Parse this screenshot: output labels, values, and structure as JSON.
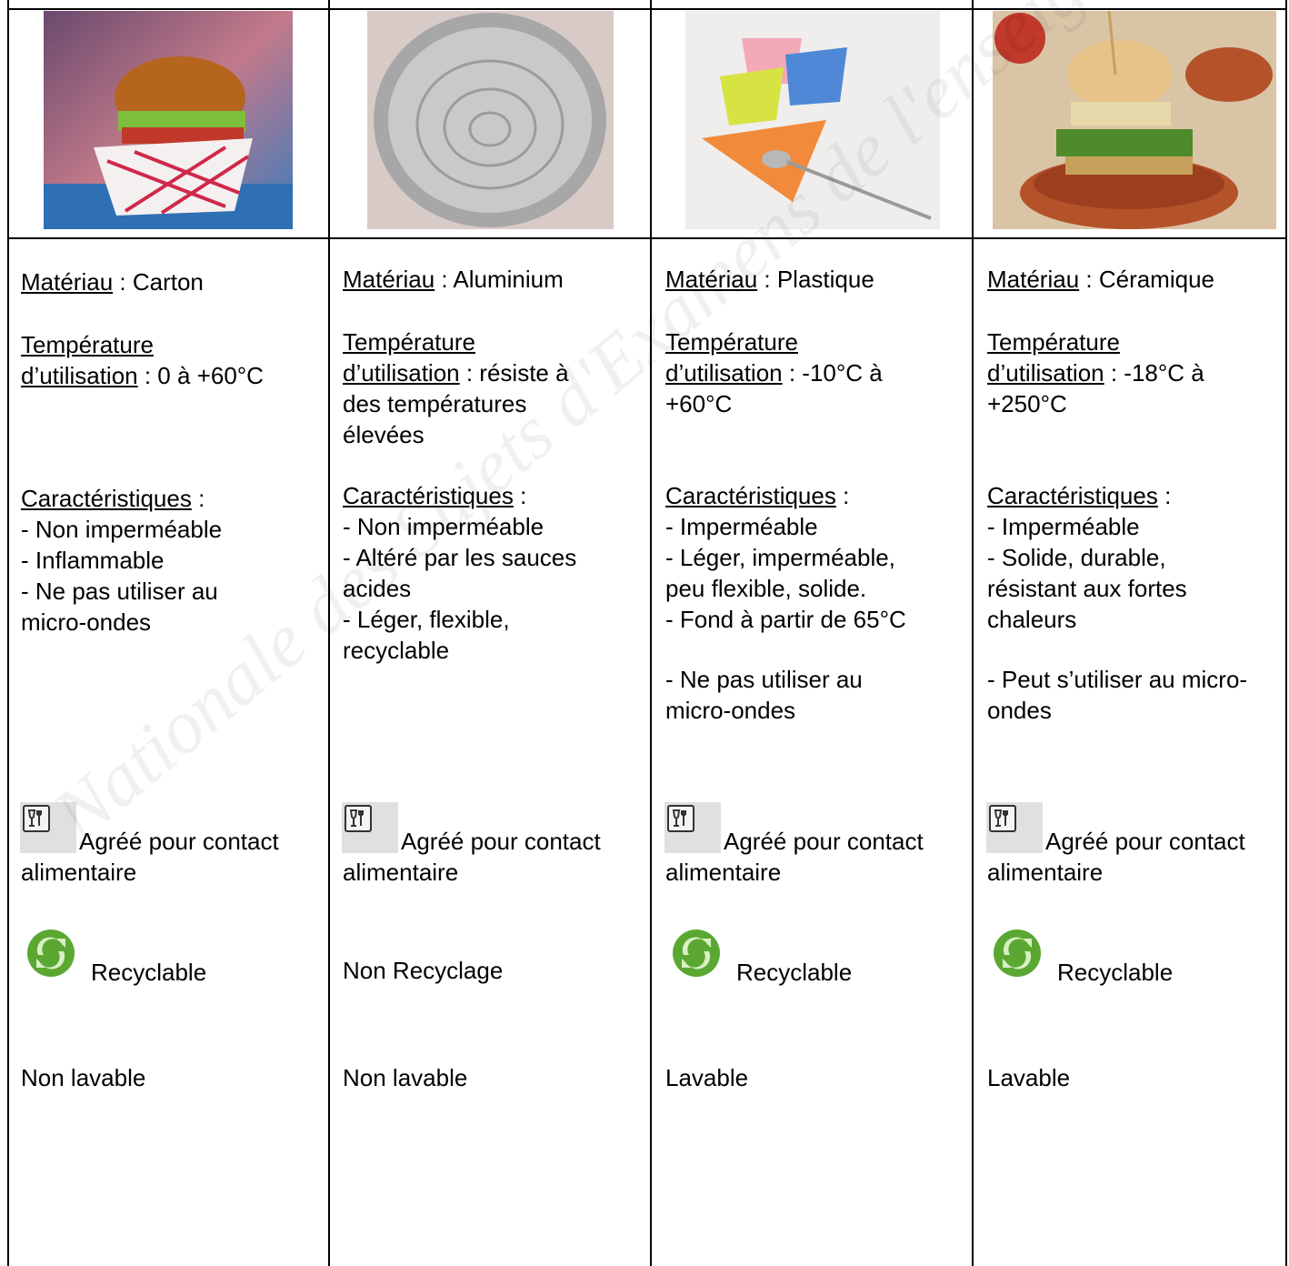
{
  "columns": [
    {
      "material_label": "Matériau",
      "material_sep": " : ",
      "material_value": "Carton",
      "temp_label_1": "Température",
      "temp_label_2": "d’utilisation",
      "temp_lines": [
        " : 0 à +60°C"
      ],
      "char_label": "Caractéristiques",
      "char_sep": " :",
      "char_lines": [
        "- Non imperméable",
        "- Inflammable",
        "- Ne pas utiliser au",
        "micro-ondes"
      ],
      "char_lines_2": [],
      "food_label_1": "Agréé pour contact",
      "food_label_2": "alimentaire",
      "recycle_text": "Recyclable",
      "recycle_icon": "recycle-icon",
      "wash_text": "Non lavable"
    },
    {
      "material_label": "Matériau",
      "material_sep": " : ",
      "material_value": "Aluminium",
      "temp_label_1": "Température",
      "temp_label_2": "d’utilisation",
      "temp_lines": [
        " : résiste à",
        "des températures",
        "élevées"
      ],
      "char_label": "Caractéristiques",
      "char_sep": " :",
      "char_lines": [
        "- Non imperméable",
        "- Altéré par les sauces",
        "acides",
        "- Léger, flexible,",
        "recyclable"
      ],
      "char_lines_2": [],
      "food_label_1": "Agréé pour contact",
      "food_label_2": "alimentaire",
      "recycle_text": "Non Recyclage",
      "recycle_icon": "",
      "wash_text": "Non lavable"
    },
    {
      "material_label": "Matériau",
      "material_sep": " : ",
      "material_value": "Plastique",
      "temp_label_1": "Température",
      "temp_label_2": "d’utilisation",
      "temp_lines": [
        " : -10°C à",
        "+60°C"
      ],
      "char_label": "Caractéristiques",
      "char_sep": " :",
      "char_lines": [
        "- Imperméable",
        "- Léger, imperméable,",
        "peu flexible, solide.",
        "- Fond à partir de 65°C"
      ],
      "char_lines_2": [
        "- Ne pas utiliser au",
        "micro-ondes"
      ],
      "food_label_1": "Agréé pour contact",
      "food_label_2": "alimentaire",
      "recycle_text": "Recyclable",
      "recycle_icon": "recycle-icon",
      "wash_text": "Lavable"
    },
    {
      "material_label": "Matériau",
      "material_sep": " : ",
      "material_value": "Céramique",
      "temp_label_1": "Température",
      "temp_label_2": "d’utilisation",
      "temp_lines": [
        " : -18°C à",
        "+250°C"
      ],
      "char_label": "Caractéristiques",
      "char_sep": " :",
      "char_lines": [
        "- Imperméable",
        "- Solide, durable,",
        "résistant aux fortes",
        "chaleurs"
      ],
      "char_lines_2": [
        "- Peut s’utiliser au micro-",
        "ondes"
      ],
      "food_label_1": "Agréé pour contact",
      "food_label_2": "alimentaire",
      "recycle_text": "Recyclable",
      "recycle_icon": "recycle-icon",
      "wash_text": "Lavable"
    }
  ],
  "watermark": "Nationale des Sujets d'Examens de l'enseignement professionnel",
  "icons": {
    "food_contact": "glass-fork-icon",
    "recycle": "recycle-icon"
  },
  "colors": {
    "border": "#000000",
    "recycle_green": "#5aa832",
    "icon_bg": "#e0e0e0"
  }
}
